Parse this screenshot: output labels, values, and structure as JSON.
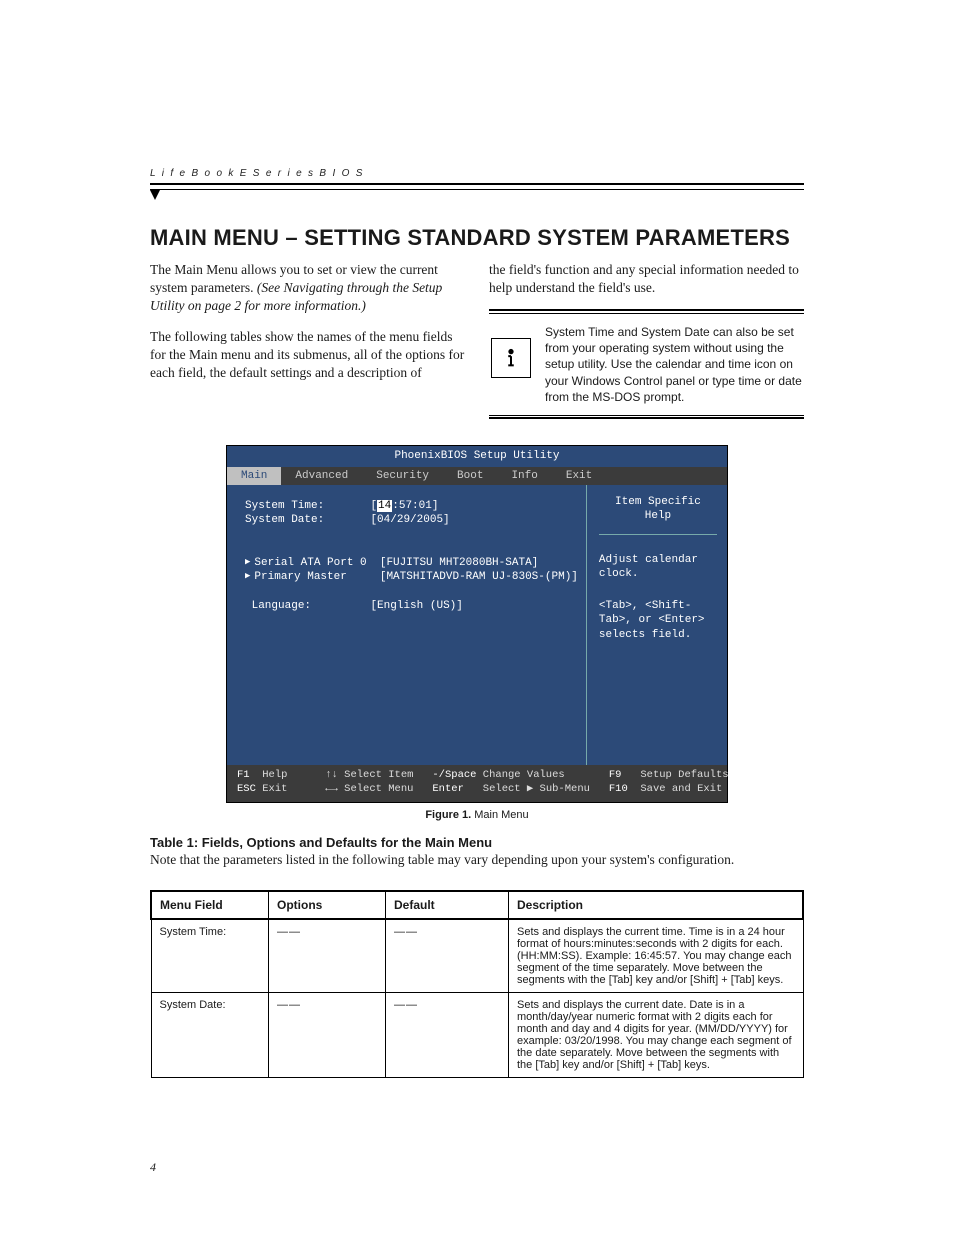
{
  "running_head": "L i f e B o o k   E   S e r i e s   B I O S",
  "section_title": "MAIN MENU – SETTING STANDARD SYSTEM PARAMETERS",
  "intro_p1_a": "The Main Menu allows you to set or view the current system parameters. ",
  "intro_p1_b": "(See Navigating through the Setup Utility on page 2 for more information.)",
  "intro_p2": "The following tables show the names of the menu fields for the Main menu and its submenus, all of the options for each field, the default settings and a description of",
  "intro_p3": "the field's function and any special information needed to help understand the field's use.",
  "note_text": "System Time and System Date can also be set from your operating system without using the setup utility. Use the calendar and time icon on your Windows Control panel or type time or date from the MS-DOS prompt.",
  "bios": {
    "title": "PhoenixBIOS Setup Utility",
    "tabs": [
      "Main",
      "Advanced",
      "Security",
      "Boot",
      "Info",
      "Exit"
    ],
    "selected_tab": "Main",
    "fields": {
      "system_time_label": "System Time:",
      "system_time_value_prefix": "[",
      "system_time_hh": "14",
      "system_time_rest": ":57:01]",
      "system_date_label": "System Date:",
      "system_date_value": "[04/29/2005]",
      "sata_label": "Serial ATA Port 0",
      "sata_value": "[FUJITSU MHT2080BH-SATA]",
      "pm_label": "Primary Master",
      "pm_value": "[MATSHITADVD-RAM UJ-830S-(PM)]",
      "lang_label": "Language:",
      "lang_value": "[English (US)]"
    },
    "help_title": "Item Specific Help",
    "help_line1": "Adjust calendar clock.",
    "help_line2": "<Tab>, <Shift-Tab>, or <Enter> selects field.",
    "footer_l1_k1": "F1",
    "footer_l1_t1": "Help",
    "footer_l1_t2": "↑↓ Select Item",
    "footer_l1_k2": "-/Space",
    "footer_l1_t3": "Change Values",
    "footer_l1_k3": "F9",
    "footer_l1_t4": "Setup Defaults",
    "footer_l2_k1": "ESC",
    "footer_l2_t1": "Exit",
    "footer_l2_t2": "←→ Select Menu",
    "footer_l2_k2": "Enter",
    "footer_l2_t3": "Select ▶ Sub-Menu",
    "footer_l2_k3": "F10",
    "footer_l2_t4": "Save and Exit"
  },
  "figure_caption_bold": "Figure 1.  ",
  "figure_caption_rest": "Main Menu",
  "table_title": "Table 1: Fields, Options and Defaults for the Main Menu",
  "table_note": "Note that the parameters listed in the following table may vary depending upon your system's configuration.",
  "table_headers": [
    "Menu Field",
    "Options",
    "Default",
    "Description"
  ],
  "table_rows": [
    {
      "menu": "System Time:",
      "options": "——",
      "default": "——",
      "desc": "Sets and displays the current time. Time is in a 24 hour format of hours:minutes:seconds with 2 digits for each. (HH:MM:SS). Example: 16:45:57. You may change each segment of the time separately. Move between the segments with the [Tab] key and/or [Shift] + [Tab] keys."
    },
    {
      "menu": "System Date:",
      "options": "——",
      "default": "——",
      "desc": "Sets and displays the current date. Date is in a month/day/year numeric format with 2 digits each for month and day and 4 digits for year. (MM/DD/YYYY) for example: 03/20/1998. You may change each segment of the date separately. Move between the segments with the [Tab] key and/or [Shift] + [Tab] keys."
    }
  ],
  "page_number": "4"
}
